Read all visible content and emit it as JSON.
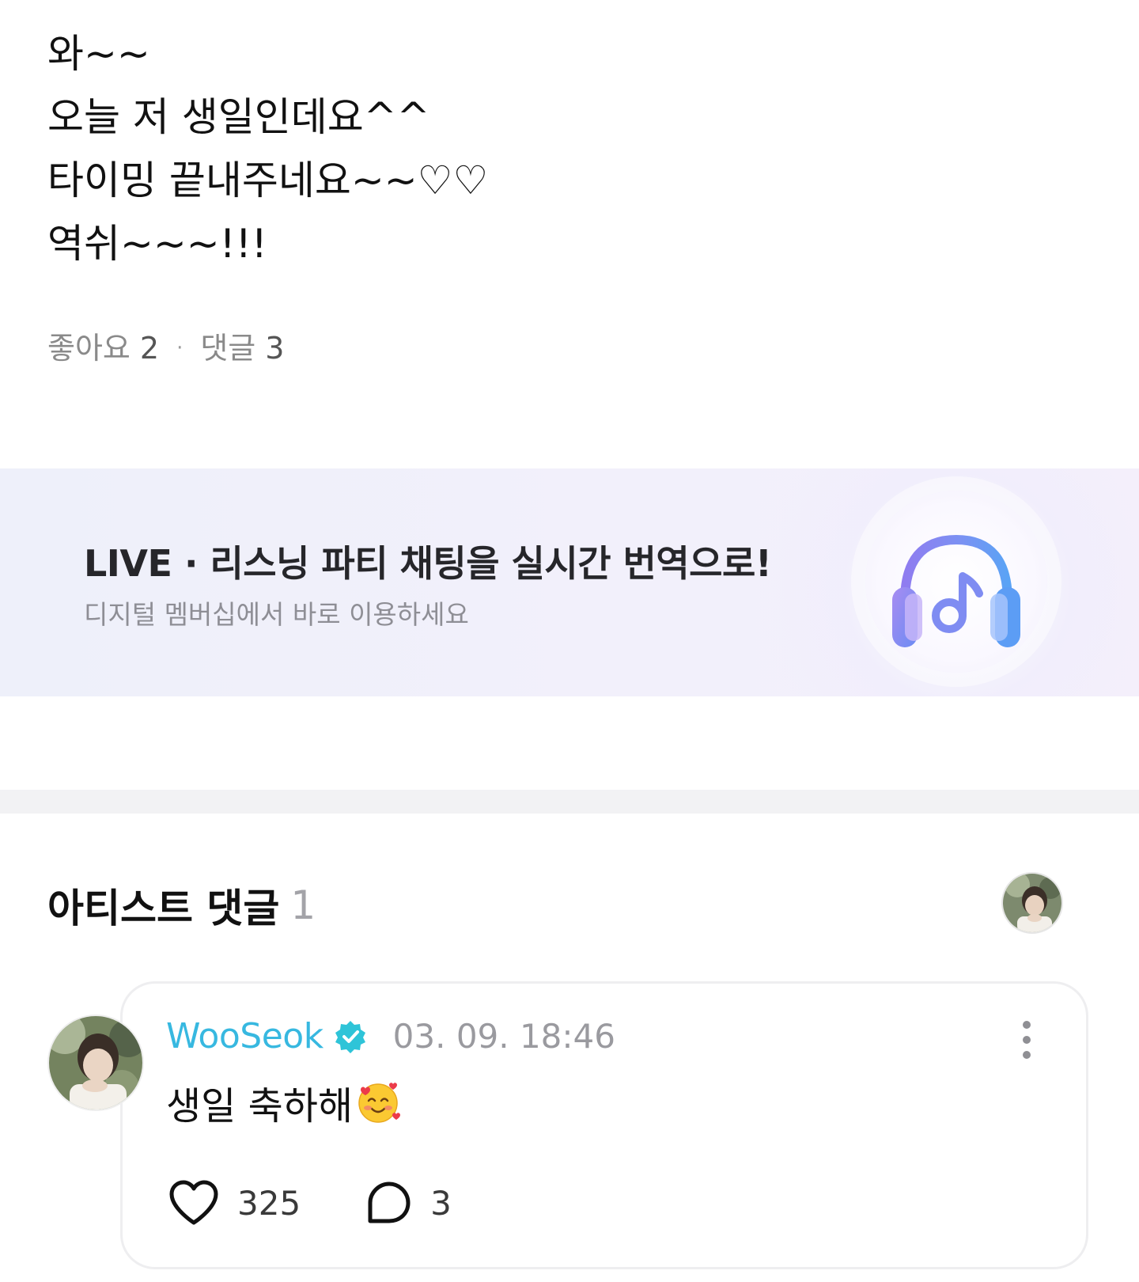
{
  "post": {
    "lines": [
      "와~~",
      "오늘 저 생일인데요^^",
      "타이밍 끝내주네요~~♡♡",
      "역쉬~~~!!!"
    ],
    "like_label": "좋아요",
    "like_count": "2",
    "separator": "·",
    "comment_label": "댓글",
    "comment_count": "3"
  },
  "banner": {
    "title": "LIVE · 리스닝 파티 채팅을 실시간 번역으로!",
    "subtitle": "디지털 멤버십에서 바로 이용하세요",
    "icon": "headphones-music-icon"
  },
  "artist_comments": {
    "title": "아티스트 댓글",
    "count": "1"
  },
  "comment": {
    "author": "WooSeok",
    "verified_icon": "verified-badge-icon",
    "date": "03. 09. 18:46",
    "text": "생일 축하해",
    "emoji": "🥰",
    "likes": "325",
    "replies": "3"
  },
  "colors": {
    "author": "#37b8e0",
    "verified": "#2ec4d8",
    "muted_text": "#8a8a8a",
    "banner_bg": "#eef0fa"
  }
}
